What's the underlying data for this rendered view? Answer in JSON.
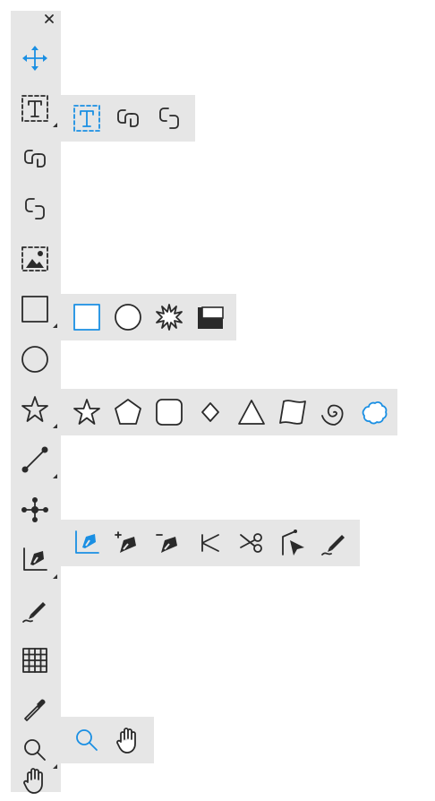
{
  "colors": {
    "panel": "#e6e6e6",
    "accent": "#1a8fe3",
    "icon": "#2a2a2a"
  },
  "toolbar": {
    "close_icon": "close-icon",
    "tools": [
      {
        "name": "move-tool",
        "icon": "move-icon",
        "selected": true
      },
      {
        "name": "text-tool",
        "icon": "text-icon",
        "has_flyout": true
      },
      {
        "name": "link-frames-tool",
        "icon": "link-icon"
      },
      {
        "name": "unlink-frames-tool",
        "icon": "unlink-icon"
      },
      {
        "name": "image-tool",
        "icon": "image-icon"
      },
      {
        "name": "rectangle-tool",
        "icon": "rectangle-icon",
        "has_flyout": true
      },
      {
        "name": "ellipse-tool",
        "icon": "circle-icon"
      },
      {
        "name": "star-tool",
        "icon": "star-icon",
        "has_flyout": true
      },
      {
        "name": "line-tool",
        "icon": "line-icon",
        "has_flyout": true
      },
      {
        "name": "node-tool",
        "icon": "nodes-icon"
      },
      {
        "name": "pen-tool",
        "icon": "bezier-pen-icon",
        "has_flyout": true
      },
      {
        "name": "pencil-tool",
        "icon": "pencil-icon"
      },
      {
        "name": "table-tool",
        "icon": "grid-icon"
      },
      {
        "name": "eyedropper-tool",
        "icon": "eyedropper-icon"
      },
      {
        "name": "zoom-tool",
        "icon": "magnifier-icon",
        "has_flyout": true
      },
      {
        "name": "hand-tool",
        "icon": "hand-icon"
      }
    ]
  },
  "flyouts": {
    "text": [
      "text-frame-icon",
      "link-icon",
      "unlink-icon"
    ],
    "rectangle": [
      "rectangle-icon",
      "circle-icon",
      "starburst-icon",
      "shadow-rectangle-icon"
    ],
    "star": [
      "star-icon",
      "pentagon-icon",
      "rounded-square-icon",
      "diamond-icon",
      "triangle-icon",
      "wave-rectangle-icon",
      "spiral-icon",
      "cloud-icon"
    ],
    "pen": [
      "bezier-pen-icon",
      "add-anchor-icon",
      "remove-anchor-icon",
      "convert-anchor-icon",
      "scissors-icon",
      "direct-select-icon",
      "pencil-icon"
    ],
    "zoom": [
      "magnifier-icon",
      "hand-icon"
    ]
  }
}
